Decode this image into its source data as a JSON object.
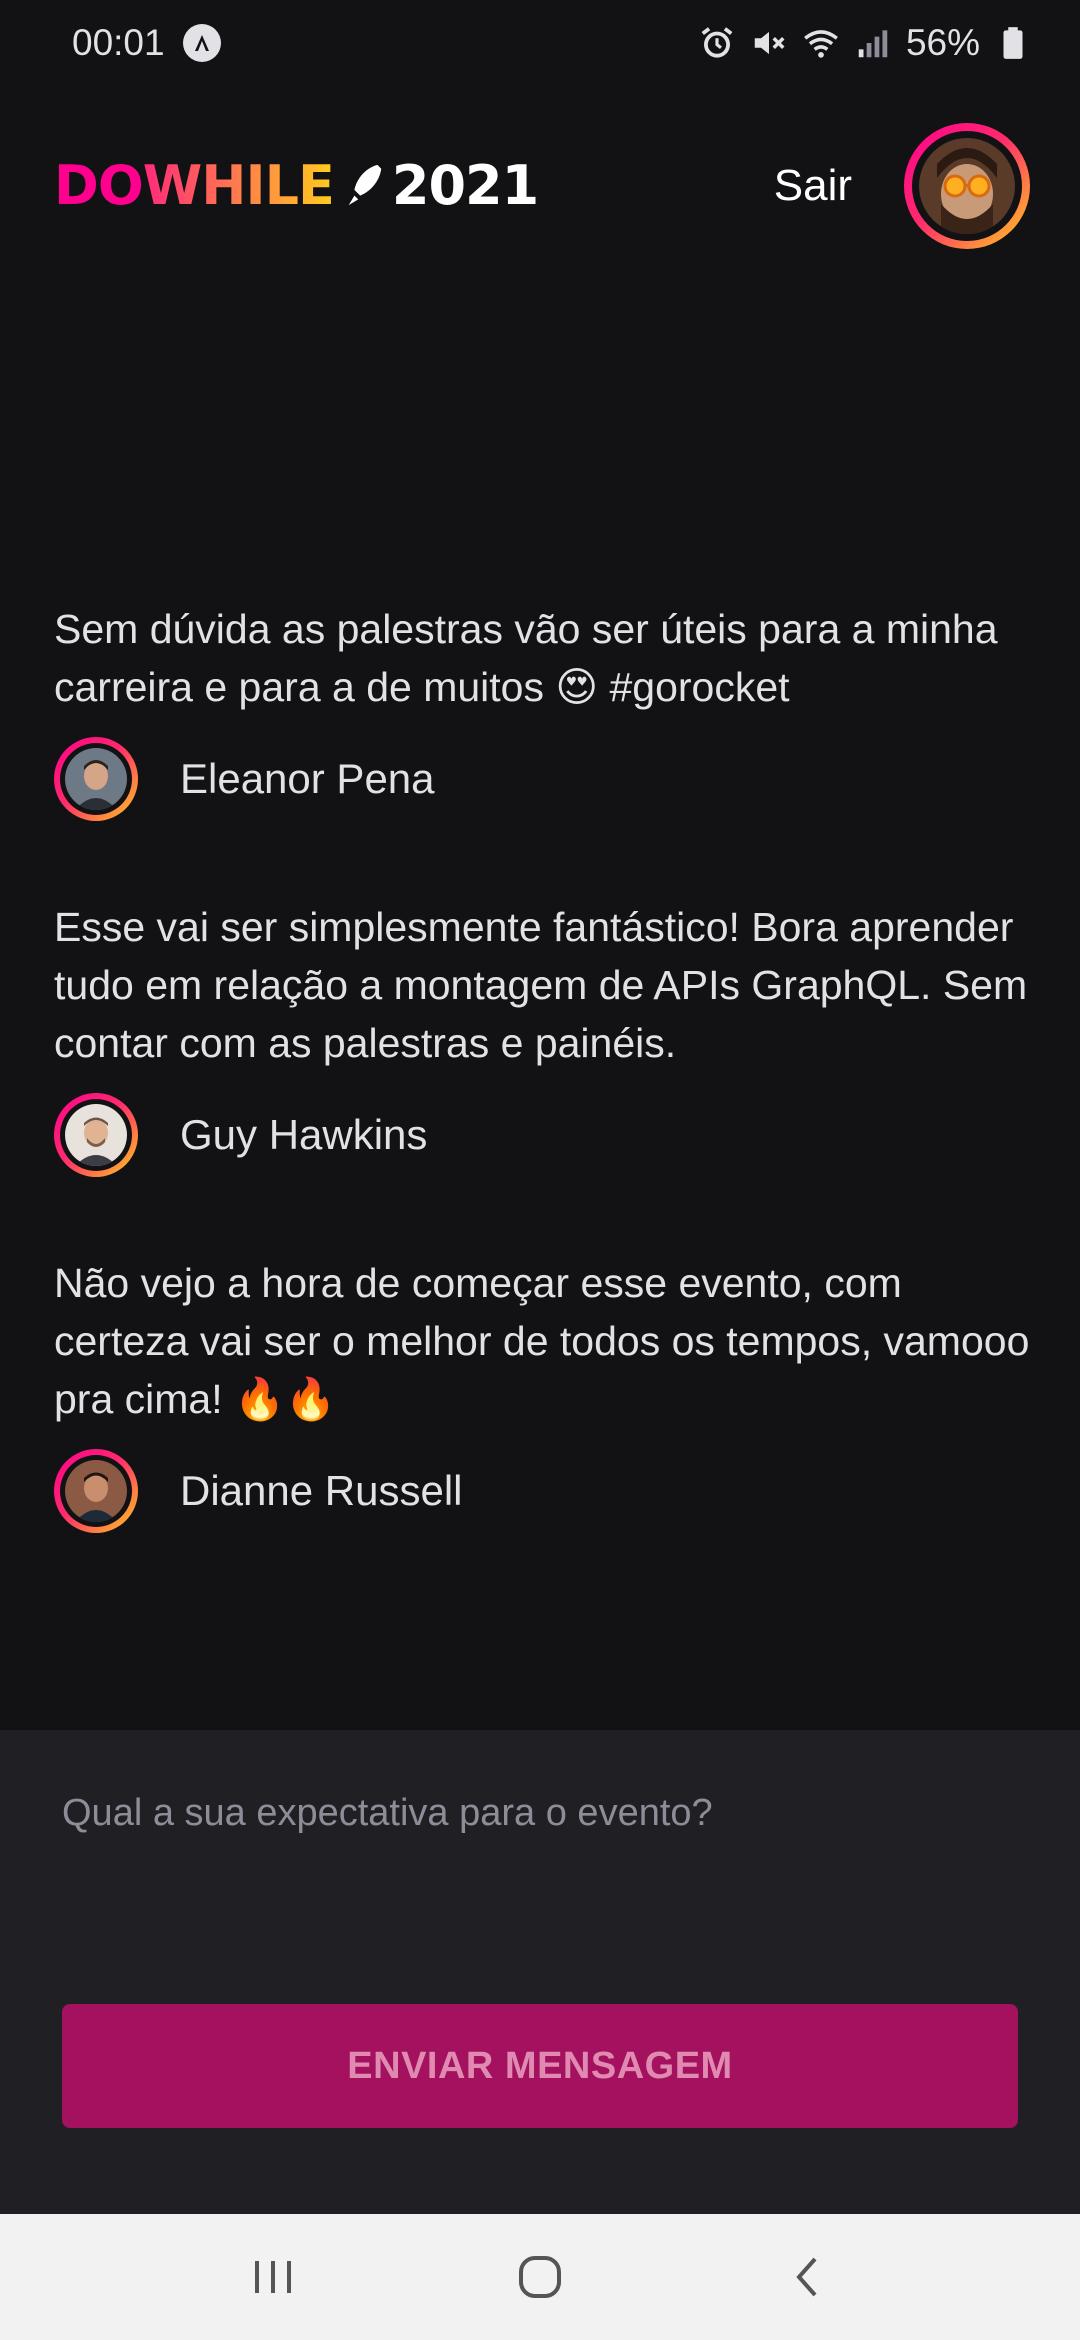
{
  "status_bar": {
    "time": "00:01",
    "battery": "56%",
    "icons": [
      "auto-icon",
      "alarm-icon",
      "mute-icon",
      "wifi-icon",
      "signal-icon",
      "battery-icon"
    ]
  },
  "header": {
    "logo": {
      "do": "DO",
      "while": "WHILE",
      "year": "2021"
    },
    "signout_label": "Sair"
  },
  "messages": [
    {
      "text": "Sem dúvida as palestras vão ser úteis para a minha carreira e para a de muitos 😍 #gorocket",
      "author": "Eleanor Pena"
    },
    {
      "text": "Esse vai ser simplesmente fantástico! Bora aprender tudo em relação a montagem de APIs GraphQL. Sem contar com as palestras e painéis.",
      "author": "Guy Hawkins"
    },
    {
      "text": "Não vejo a hora de começar esse evento, com certeza vai ser o melhor de todos os tempos, vamooo pra cima! 🔥🔥",
      "author": "Dianne Russell"
    }
  ],
  "composer": {
    "placeholder": "Qual a sua expectativa para o evento?",
    "send_label": "ENVIAR MENSAGEM"
  },
  "colors": {
    "background": "#121214",
    "composer_bg": "#202024",
    "accent_pink": "#ff008e",
    "accent_yellow": "#ffcd1e",
    "button_bg": "#a3115f"
  }
}
